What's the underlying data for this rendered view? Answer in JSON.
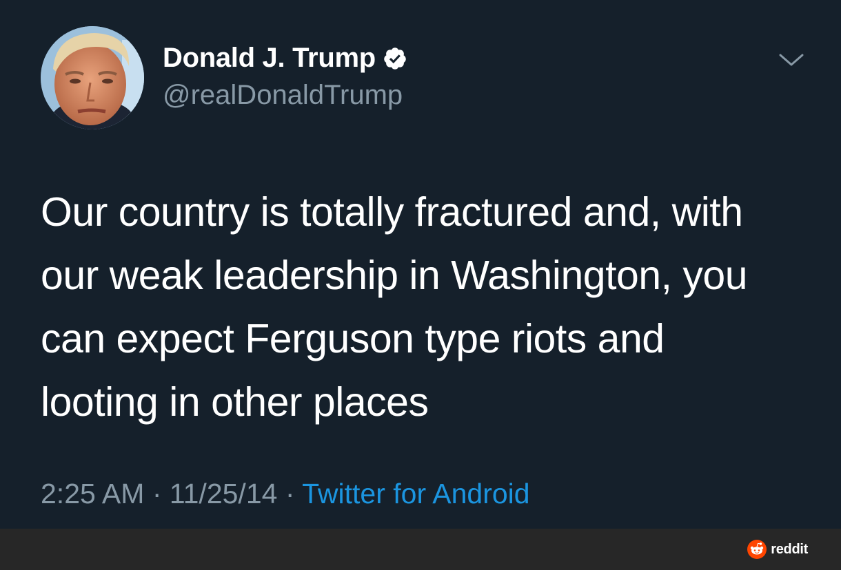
{
  "tweet": {
    "author": {
      "display_name": "Donald J. Trump",
      "handle": "@realDonaldTrump",
      "verified": true,
      "verified_icon": "verified-badge-icon"
    },
    "menu_icon": "chevron-down-icon",
    "text": "Our country is totally fractured and, with\nour weak leadership in Washington, you\ncan expect Ferguson type riots and\nlooting in other places",
    "time": "2:25 AM",
    "separator": " · ",
    "date": "11/25/14",
    "source": "Twitter for Android"
  },
  "footer": {
    "watermark_icon": "reddit-logo-icon",
    "watermark_text": "reddit"
  },
  "colors": {
    "background": "#15202b",
    "text": "#ffffff",
    "secondary_text": "#8899a6",
    "link": "#1b95e0",
    "footer_bar": "#272727",
    "reddit_orange": "#ff4500"
  }
}
